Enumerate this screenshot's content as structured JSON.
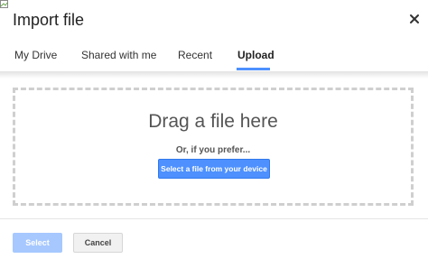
{
  "dialog": {
    "title": "Import file",
    "close_icon": "close-icon"
  },
  "tabs": [
    {
      "label": "My Drive",
      "active": false
    },
    {
      "label": "Shared with me",
      "active": false
    },
    {
      "label": "Recent",
      "active": false
    },
    {
      "label": "Upload",
      "active": true
    }
  ],
  "upload": {
    "drag_text": "Drag a file here",
    "prefer_text": "Or, if you prefer...",
    "select_device_label": "Select a file from your device"
  },
  "footer": {
    "select_label": "Select",
    "cancel_label": "Cancel"
  },
  "colors": {
    "accent": "#4d90fe",
    "disabled_accent": "#a6c8ff",
    "dropzone_border": "#cfcfcf"
  }
}
